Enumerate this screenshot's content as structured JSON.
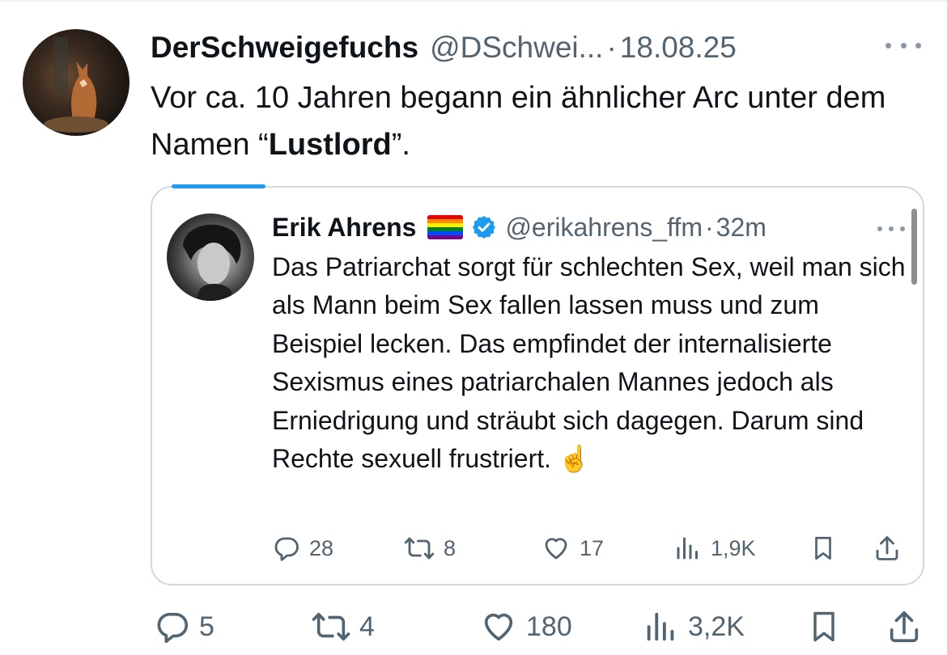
{
  "tweet": {
    "display_name": "DerSchweigefuchs",
    "handle": "@DSchwei...",
    "separator": "·",
    "date": "18.08.25",
    "text_before": "Vor ca. 10 Jahren begann ein ähnlicher Arc unter dem Namen “",
    "text_bold": "Lustlord",
    "text_after": "”.",
    "stats": {
      "replies": "5",
      "reposts": "4",
      "likes": "180",
      "views": "3,2K"
    }
  },
  "quoted": {
    "display_name": "Erik Ahrens",
    "handle": "@erikahrens_ffm",
    "separator": "·",
    "time": "32m",
    "text": "Das Patriarchat sorgt für schlechten Sex, weil man sich als Mann beim Sex fallen lassen muss und zum Beispiel lecken. Das empfindet der internalisierte Sexismus eines patriarchalen Mannes jedoch als Erniedrigung und sträubt sich dagegen. Darum sind Rechte sexuell frustriert.",
    "emoji": "☝️",
    "stats": {
      "replies": "28",
      "reposts": "8",
      "likes": "17",
      "views": "1,9K"
    }
  },
  "icons": {
    "reply": "reply-icon",
    "repost": "repost-icon",
    "like": "heart-icon",
    "views": "views-icon",
    "bookmark": "bookmark-icon",
    "share": "share-icon",
    "more": "more-icon",
    "verified": "verified-badge-icon",
    "flag": "rainbow-flag-icon"
  },
  "colors": {
    "text": "#0f1419",
    "secondary": "#536471",
    "border": "#cfd9de",
    "accent": "#1d9bf0"
  }
}
